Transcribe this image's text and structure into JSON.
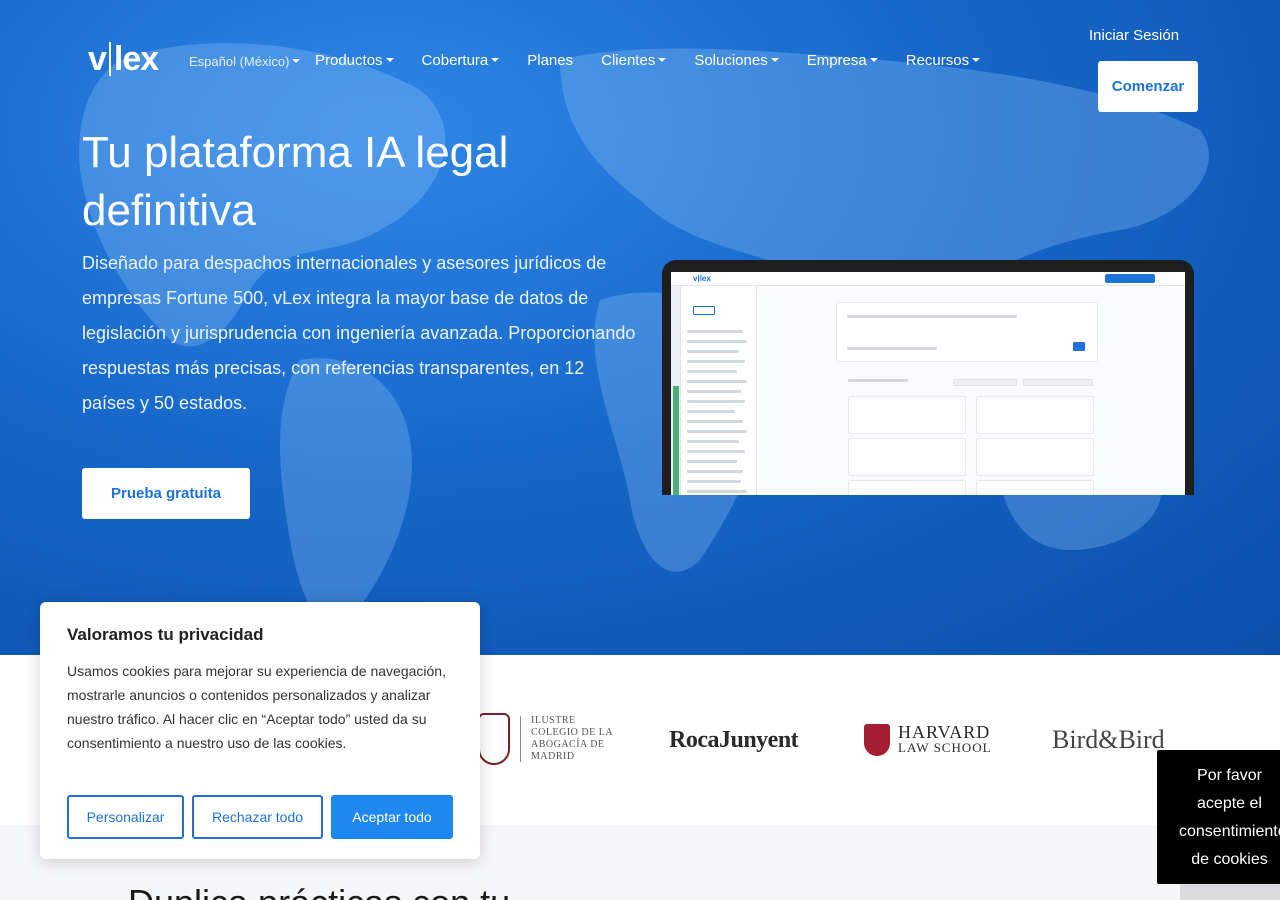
{
  "header": {
    "logo_text": "vlex",
    "language": "Español (México)",
    "nav": [
      "Productos",
      "Cobertura",
      "Planes",
      "Clientes",
      "Soluciones",
      "Empresa",
      "Recursos"
    ],
    "signin_label": "Iniciar Sesión",
    "start_label": "Comenzar"
  },
  "hero": {
    "title": "Tu plataforma IA legal definitiva",
    "description": "Diseñado para despachos internacionales y asesores jurídicos de empresas Fortune 500, vLex integra la mayor base de datos de legislación y jurisprudencia con ingeniería avanzada. Proporcionando respuestas más precisas, con referencias transparentes, en 12 países y 50 estados.",
    "cta_label": "Prueba gratuita"
  },
  "logos": {
    "icam": "ILUSTRE COLEGIO DE LA ABOGACÍA DE MADRID",
    "roca": "RocaJunyent",
    "harvard_1": "HARVARD",
    "harvard_2": "LAW SCHOOL",
    "bird": "Bird&Bird"
  },
  "below": {
    "heading": "Duplica prácticas con tu"
  },
  "cookie": {
    "title": "Valoramos tu privacidad",
    "text": "Usamos cookies para mejorar su experiencia de navegación, mostrarle anuncios o contenidos personalizados y analizar nuestro tráfico. Al hacer clic en “Aceptar todo” usted da su consentimiento a nuestro uso de las cookies.",
    "customize_label": "Personalizar",
    "reject_label": "Rechazar todo",
    "accept_label": "Aceptar todo"
  },
  "consent_toast": {
    "line1": "Por favor",
    "line2": "acepte el",
    "line3": "consentimiento",
    "line4": "de cookies"
  },
  "colors": {
    "hero_blue": "#1667c9",
    "accent": "#1e73d8",
    "accept_button": "#1e87f0"
  }
}
